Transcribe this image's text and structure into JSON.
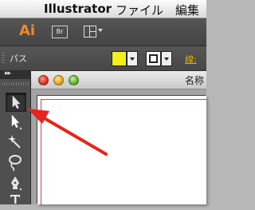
{
  "menubar": {
    "app_name": "Illustrator",
    "file_menu": "ファイル",
    "edit_menu": "編集"
  },
  "appbar": {
    "logo": "Ai",
    "bridge_button": "Br",
    "arrange_icon": "arrange-documents-icon"
  },
  "controlbar": {
    "selection_label": "パス",
    "fill_color": "#f4ee19",
    "stroke_label": "線:"
  },
  "tools": {
    "collapse_glyph": "▸▸",
    "items": [
      {
        "name": "selection-tool",
        "icon": "arrow-icon",
        "selected": true
      },
      {
        "name": "direct-selection-tool",
        "icon": "white-arrow-icon",
        "selected": false
      },
      {
        "name": "magic-wand-tool",
        "icon": "magic-wand-icon",
        "selected": false
      },
      {
        "name": "lasso-tool",
        "icon": "lasso-icon",
        "selected": false
      },
      {
        "name": "pen-tool",
        "icon": "pen-icon",
        "selected": false
      },
      {
        "name": "type-tool",
        "icon": "type-icon",
        "selected": false
      }
    ]
  },
  "document": {
    "title": "名称"
  },
  "annotation": {
    "color": "#e8231b"
  }
}
